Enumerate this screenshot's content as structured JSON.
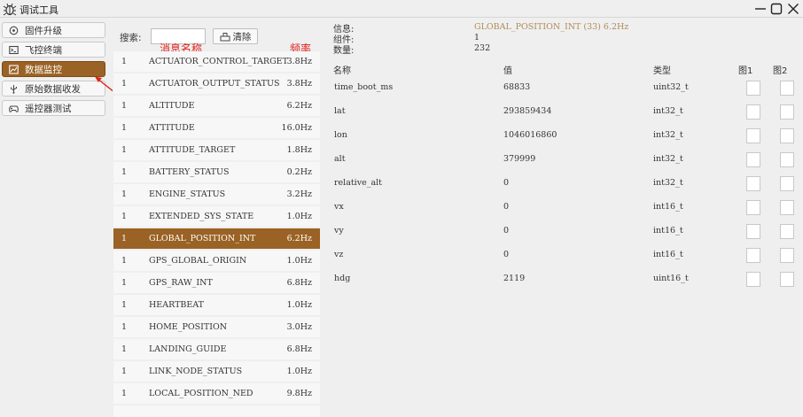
{
  "window": {
    "title": "调试工具"
  },
  "sidebar": {
    "items": [
      {
        "label": "固件升级",
        "icon": "firmware-icon"
      },
      {
        "label": "飞控终端",
        "icon": "terminal-icon"
      },
      {
        "label": "数据监控",
        "icon": "chart-icon",
        "active": true
      },
      {
        "label": "原始数据收发",
        "icon": "usb-icon"
      },
      {
        "label": "遥控器测试",
        "icon": "gamepad-icon"
      }
    ]
  },
  "search": {
    "label": "搜索:",
    "value": "",
    "clear_label": "清除"
  },
  "annotations": {
    "name": "消息名称",
    "freq": "频率"
  },
  "messages": [
    {
      "count": "1",
      "name": "ACTUATOR_CONTROL_TARGET",
      "freq": "3.8Hz"
    },
    {
      "count": "1",
      "name": "ACTUATOR_OUTPUT_STATUS",
      "freq": "3.8Hz"
    },
    {
      "count": "1",
      "name": "ALTITUDE",
      "freq": "6.2Hz"
    },
    {
      "count": "1",
      "name": "ATTITUDE",
      "freq": "16.0Hz"
    },
    {
      "count": "1",
      "name": "ATTITUDE_TARGET",
      "freq": "1.8Hz"
    },
    {
      "count": "1",
      "name": "BATTERY_STATUS",
      "freq": "0.2Hz"
    },
    {
      "count": "1",
      "name": "ENGINE_STATUS",
      "freq": "3.2Hz"
    },
    {
      "count": "1",
      "name": "EXTENDED_SYS_STATE",
      "freq": "1.0Hz"
    },
    {
      "count": "1",
      "name": "GLOBAL_POSITION_INT",
      "freq": "6.2Hz",
      "selected": true
    },
    {
      "count": "1",
      "name": "GPS_GLOBAL_ORIGIN",
      "freq": "1.0Hz"
    },
    {
      "count": "1",
      "name": "GPS_RAW_INT",
      "freq": "6.8Hz"
    },
    {
      "count": "1",
      "name": "HEARTBEAT",
      "freq": "1.0Hz"
    },
    {
      "count": "1",
      "name": "HOME_POSITION",
      "freq": "3.0Hz"
    },
    {
      "count": "1",
      "name": "LANDING_GUIDE",
      "freq": "6.8Hz"
    },
    {
      "count": "1",
      "name": "LINK_NODE_STATUS",
      "freq": "1.0Hz"
    },
    {
      "count": "1",
      "name": "LOCAL_POSITION_NED",
      "freq": "9.8Hz"
    }
  ],
  "detail": {
    "info_label": "信息:",
    "info_value": "GLOBAL_POSITION_INT (33) 6.2Hz",
    "component_label": "组件:",
    "component_value": "1",
    "count_label": "数量:",
    "count_value": "232",
    "headers": {
      "name": "名称",
      "value": "值",
      "type": "类型",
      "chart1": "图1",
      "chart2": "图2"
    },
    "fields": [
      {
        "name": "time_boot_ms",
        "value": "68833",
        "type": "uint32_t"
      },
      {
        "name": "lat",
        "value": "293859434",
        "type": "int32_t"
      },
      {
        "name": "lon",
        "value": "1046016860",
        "type": "int32_t"
      },
      {
        "name": "alt",
        "value": "379999",
        "type": "int32_t"
      },
      {
        "name": "relative_alt",
        "value": "0",
        "type": "int32_t"
      },
      {
        "name": "vx",
        "value": "0",
        "type": "int16_t"
      },
      {
        "name": "vy",
        "value": "0",
        "type": "int16_t"
      },
      {
        "name": "vz",
        "value": "0",
        "type": "int16_t"
      },
      {
        "name": "hdg",
        "value": "2119",
        "type": "uint16_t"
      }
    ]
  },
  "colors": {
    "accent": "#9a6224",
    "annotation": "#e0221a",
    "info": "#b08a5a"
  }
}
